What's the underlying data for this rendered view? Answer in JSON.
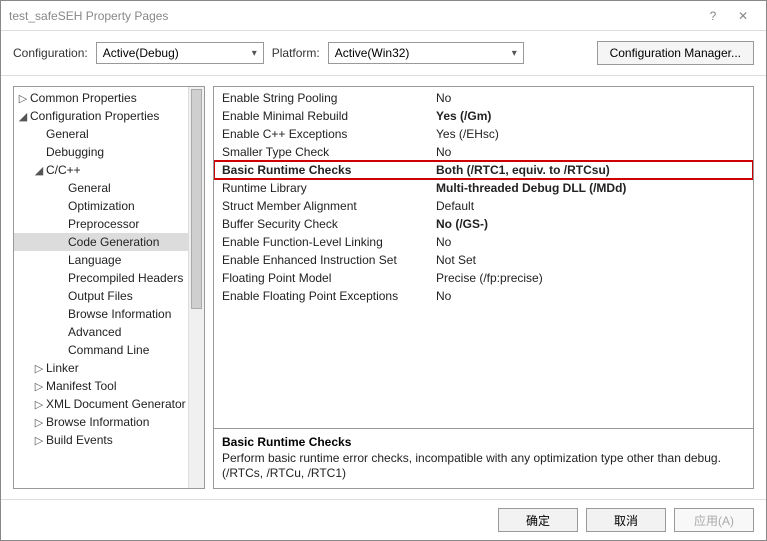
{
  "title": "test_safeSEH Property Pages",
  "config_label": "Configuration:",
  "platform_label": "Platform:",
  "config_value": "Active(Debug)",
  "platform_value": "Active(Win32)",
  "cfg_mgr": "Configuration Manager...",
  "tree": [
    {
      "label": "Common Properties",
      "lvl": 0,
      "tw": "▷"
    },
    {
      "label": "Configuration Properties",
      "lvl": 0,
      "tw": "◢"
    },
    {
      "label": "General",
      "lvl": 1,
      "tw": ""
    },
    {
      "label": "Debugging",
      "lvl": 1,
      "tw": ""
    },
    {
      "label": "C/C++",
      "lvl": 1,
      "tw": "◢"
    },
    {
      "label": "General",
      "lvl": 2,
      "tw": ""
    },
    {
      "label": "Optimization",
      "lvl": 2,
      "tw": ""
    },
    {
      "label": "Preprocessor",
      "lvl": 2,
      "tw": ""
    },
    {
      "label": "Code Generation",
      "lvl": 2,
      "tw": "",
      "sel": true
    },
    {
      "label": "Language",
      "lvl": 2,
      "tw": ""
    },
    {
      "label": "Precompiled Headers",
      "lvl": 2,
      "tw": ""
    },
    {
      "label": "Output Files",
      "lvl": 2,
      "tw": ""
    },
    {
      "label": "Browse Information",
      "lvl": 2,
      "tw": ""
    },
    {
      "label": "Advanced",
      "lvl": 2,
      "tw": ""
    },
    {
      "label": "Command Line",
      "lvl": 2,
      "tw": ""
    },
    {
      "label": "Linker",
      "lvl": 1,
      "tw": "▷"
    },
    {
      "label": "Manifest Tool",
      "lvl": 1,
      "tw": "▷"
    },
    {
      "label": "XML Document Generator",
      "lvl": 1,
      "tw": "▷"
    },
    {
      "label": "Browse Information",
      "lvl": 1,
      "tw": "▷"
    },
    {
      "label": "Build Events",
      "lvl": 1,
      "tw": "▷"
    }
  ],
  "props": [
    {
      "k": "Enable String Pooling",
      "v": "No"
    },
    {
      "k": "Enable Minimal Rebuild",
      "v": "Yes (/Gm)",
      "bold": true
    },
    {
      "k": "Enable C++ Exceptions",
      "v": "Yes (/EHsc)"
    },
    {
      "k": "Smaller Type Check",
      "v": "No"
    },
    {
      "k": "Basic Runtime Checks",
      "v": "Both (/RTC1, equiv. to /RTCsu)",
      "bold": true,
      "hl": true
    },
    {
      "k": "Runtime Library",
      "v": "Multi-threaded Debug DLL (/MDd)",
      "bold": true
    },
    {
      "k": "Struct Member Alignment",
      "v": "Default"
    },
    {
      "k": "Buffer Security Check",
      "v": "No (/GS-)",
      "bold": true
    },
    {
      "k": "Enable Function-Level Linking",
      "v": "No"
    },
    {
      "k": "Enable Enhanced Instruction Set",
      "v": "Not Set"
    },
    {
      "k": "Floating Point Model",
      "v": "Precise (/fp:precise)"
    },
    {
      "k": "Enable Floating Point Exceptions",
      "v": "No"
    }
  ],
  "desc_title": "Basic Runtime Checks",
  "desc_body": "Perform basic runtime error checks, incompatible with any optimization type other than debug.     (/RTCs, /RTCu, /RTC1)",
  "buttons": {
    "ok": "确定",
    "cancel": "取消",
    "apply": "应用(A)"
  }
}
